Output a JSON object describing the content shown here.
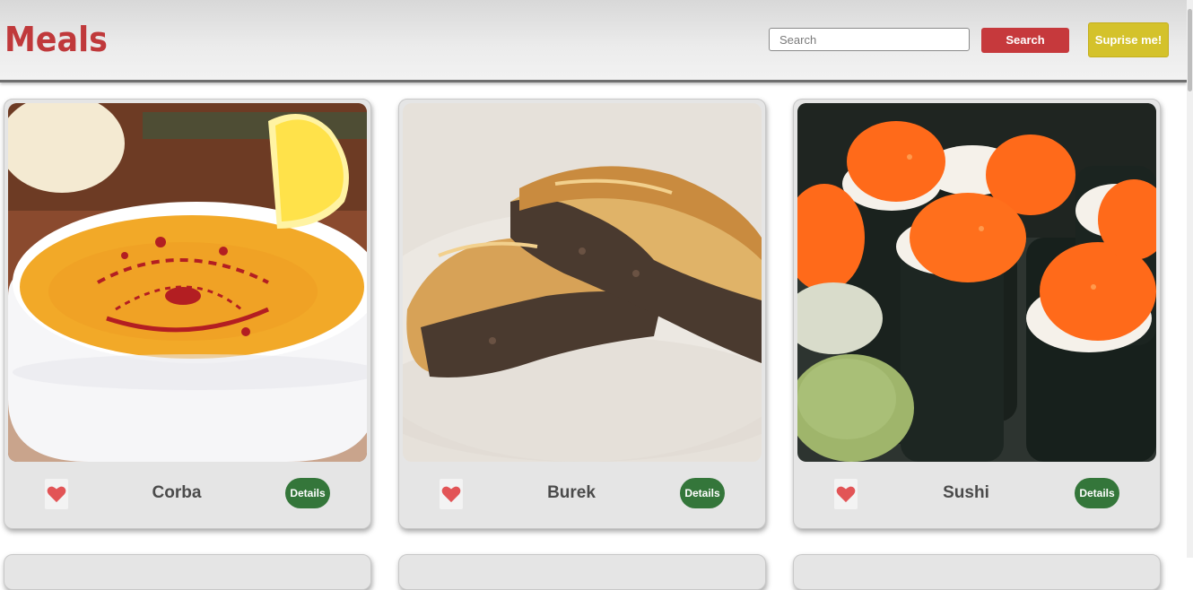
{
  "header": {
    "brand": "Meals",
    "search_placeholder": "Search",
    "search_value": "",
    "search_button": "Search",
    "surprise_button": "Suprise me!"
  },
  "colors": {
    "brand": "#c0393b",
    "search_button": "#c6393c",
    "surprise_button": "#d4c22b",
    "details_button": "#34763a",
    "heart": "#e25456"
  },
  "meals": [
    {
      "name": "Corba",
      "details_label": "Details",
      "favorite_icon": "heart-icon",
      "image": "lentil-soup-photo"
    },
    {
      "name": "Burek",
      "details_label": "Details",
      "favorite_icon": "heart-icon",
      "image": "burek-pastry-photo"
    },
    {
      "name": "Sushi",
      "details_label": "Details",
      "favorite_icon": "heart-icon",
      "image": "sushi-rolls-photo"
    }
  ]
}
